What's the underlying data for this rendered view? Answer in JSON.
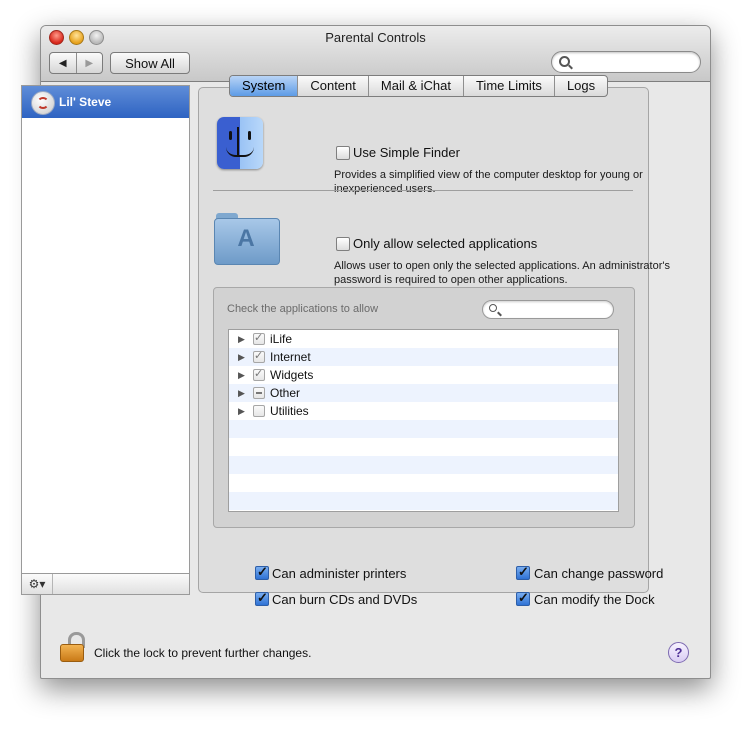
{
  "window": {
    "title": "Parental Controls"
  },
  "toolbar": {
    "back_icon": "◀",
    "forward_icon": "▶",
    "show_all_label": "Show All",
    "search_placeholder": ""
  },
  "sidebar": {
    "users": [
      {
        "name": "Lil' Steve",
        "selected": true
      }
    ],
    "gear_icon": "⚙▾"
  },
  "tabs": [
    {
      "label": "System",
      "active": true
    },
    {
      "label": "Content",
      "active": false
    },
    {
      "label": "Mail & iChat",
      "active": false
    },
    {
      "label": "Time Limits",
      "active": false
    },
    {
      "label": "Logs",
      "active": false
    }
  ],
  "options": {
    "simple_finder": {
      "label": "Use Simple Finder",
      "checked": false,
      "description": "Provides a simplified view of the computer desktop for young or inexperienced users."
    },
    "selected_apps": {
      "label": "Only allow selected applications",
      "checked": false,
      "description": "Allows user to open only the selected applications. An administrator's password is required to open other applications."
    }
  },
  "apps": {
    "title": "Check the applications to allow",
    "search_placeholder": "",
    "items": [
      {
        "label": "iLife",
        "state": "checked"
      },
      {
        "label": "Internet",
        "state": "checked"
      },
      {
        "label": "Widgets",
        "state": "checked"
      },
      {
        "label": "Other",
        "state": "mixed"
      },
      {
        "label": "Utilities",
        "state": "unchecked"
      }
    ]
  },
  "permissions": [
    {
      "label": "Can administer printers",
      "checked": true
    },
    {
      "label": "Can change password",
      "checked": true
    },
    {
      "label": "Can burn CDs and DVDs",
      "checked": true
    },
    {
      "label": "Can modify the Dock",
      "checked": true
    }
  ],
  "footer": {
    "lock_text": "Click the lock to prevent further changes.",
    "help_label": "?"
  },
  "colors": {
    "selection": "#3d72cc",
    "tab_active": "#7db0ee",
    "row_stripe": "#edf3fe"
  }
}
